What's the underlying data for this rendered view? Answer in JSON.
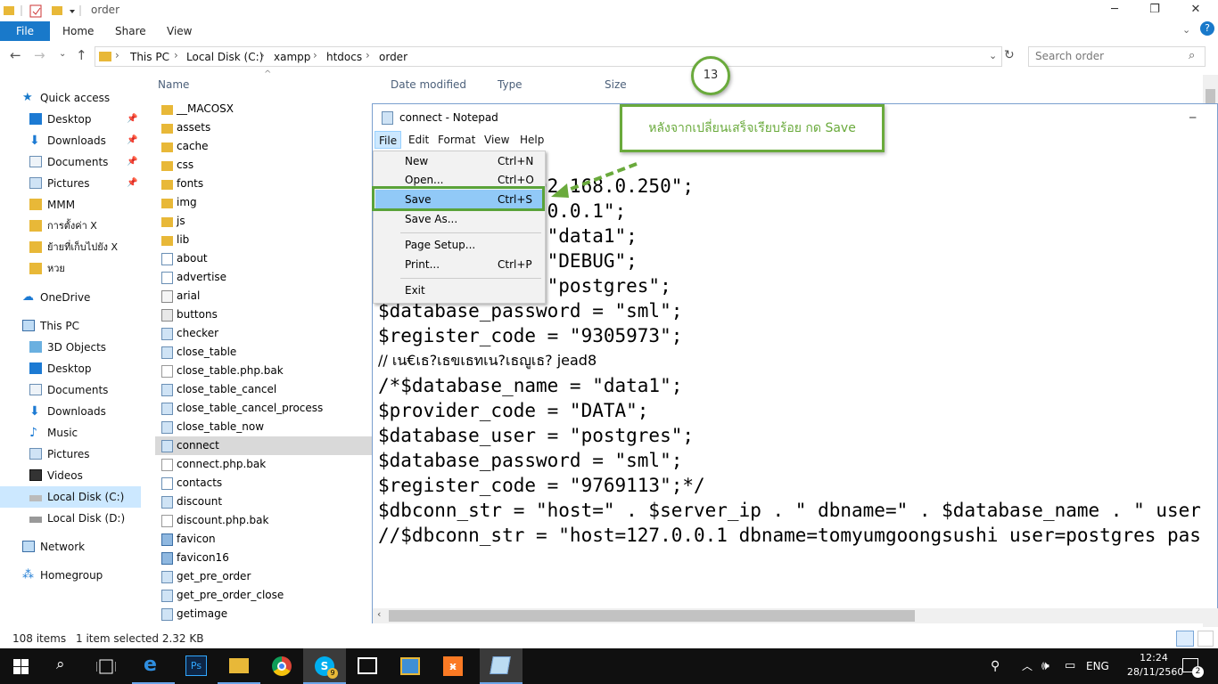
{
  "explorer": {
    "title": "order",
    "ribbon_tabs": {
      "file": "File",
      "home": "Home",
      "share": "Share",
      "view": "View"
    },
    "breadcrumb": [
      "This PC",
      "Local Disk (C:)",
      "xampp",
      "htdocs",
      "order"
    ],
    "search_placeholder": "Search order",
    "columns": {
      "name": "Name",
      "date": "Date modified",
      "type": "Type",
      "size": "Size"
    },
    "nav": {
      "quick_access": "Quick access",
      "desktop": "Desktop",
      "downloads": "Downloads",
      "documents": "Documents",
      "pictures": "Pictures",
      "mmm": "MMM",
      "settings_x": "การตั้งค่า X",
      "move_x": "ย้ายที่เก็บไปยัง X",
      "lost": "หวย",
      "onedrive": "OneDrive",
      "this_pc": "This PC",
      "objects_3d": "3D Objects",
      "desktop2": "Desktop",
      "documents2": "Documents",
      "downloads2": "Downloads",
      "music": "Music",
      "pictures2": "Pictures",
      "videos": "Videos",
      "local_c": "Local Disk (C:)",
      "local_d": "Local Disk (D:)",
      "network": "Network",
      "homegroup": "Homegroup"
    },
    "files": [
      {
        "name": "__MACOSX",
        "icon": "folder-icon"
      },
      {
        "name": "assets",
        "icon": "folder-icon"
      },
      {
        "name": "cache",
        "icon": "folder-icon"
      },
      {
        "name": "css",
        "icon": "folder-icon"
      },
      {
        "name": "fonts",
        "icon": "folder-icon"
      },
      {
        "name": "img",
        "icon": "folder-icon"
      },
      {
        "name": "js",
        "icon": "folder-icon"
      },
      {
        "name": "lib",
        "icon": "folder-icon"
      },
      {
        "name": "about",
        "icon": "html-file-icon"
      },
      {
        "name": "advertise",
        "icon": "html-file-icon"
      },
      {
        "name": "arial",
        "icon": "font-file-icon"
      },
      {
        "name": "buttons",
        "icon": "settings-file-icon"
      },
      {
        "name": "checker",
        "icon": "php-file-icon"
      },
      {
        "name": "close_table",
        "icon": "php-file-icon"
      },
      {
        "name": "close_table.php.bak",
        "icon": "blank-file-icon"
      },
      {
        "name": "close_table_cancel",
        "icon": "php-file-icon"
      },
      {
        "name": "close_table_cancel_process",
        "icon": "php-file-icon"
      },
      {
        "name": "close_table_now",
        "icon": "php-file-icon"
      },
      {
        "name": "connect",
        "icon": "php-file-icon",
        "selected": true
      },
      {
        "name": "connect.php.bak",
        "icon": "blank-file-icon"
      },
      {
        "name": "contacts",
        "icon": "html-file-icon"
      },
      {
        "name": "discount",
        "icon": "php-file-icon"
      },
      {
        "name": "discount.php.bak",
        "icon": "blank-file-icon"
      },
      {
        "name": "favicon",
        "icon": "image-file-icon"
      },
      {
        "name": "favicon16",
        "icon": "image-file-icon"
      },
      {
        "name": "get_pre_order",
        "icon": "php-file-icon"
      },
      {
        "name": "get_pre_order_close",
        "icon": "php-file-icon"
      },
      {
        "name": "getimage",
        "icon": "php-file-icon"
      }
    ],
    "status": {
      "count": "108 items",
      "selected": "1 item selected  2.32 KB"
    }
  },
  "notepad": {
    "title": "connect - Notepad",
    "menu": {
      "file": "File",
      "edit": "Edit",
      "format": "Format",
      "view": "View",
      "help": "Help"
    },
    "lines": [
      "             192.168.0.250\";",
      "             7.0.0.1\";",
      "             = \"data1\";",
      "             = \"DEBUG\";",
      "             = \"postgres\";",
      "$database_password = \"sml\";",
      "$register_code = \"9305973\";",
      "",
      "// เน€เธ?เธขเธทเน?เธญูเธ? jead8",
      "/*$database_name = \"data1\";",
      "$provider_code = \"DATA\";",
      "$database_user = \"postgres\";",
      "$database_password = \"sml\";",
      "$register_code = \"9769113\";*/",
      "",
      "$dbconn_str = \"host=\" . $server_ip . \" dbname=\" . $database_name . \" user",
      "//$dbconn_str = \"host=127.0.0.1 dbname=tomyumgoongsushi user=postgres pas"
    ]
  },
  "file_menu": {
    "new": "New",
    "new_sc": "Ctrl+N",
    "open": "Open...",
    "open_sc": "Ctrl+O",
    "save": "Save",
    "save_sc": "Ctrl+S",
    "save_as": "Save As...",
    "page_setup": "Page Setup...",
    "print": "Print...",
    "print_sc": "Ctrl+P",
    "exit": "Exit"
  },
  "annotation": {
    "step": "13",
    "callout": "หลังจากเปลี่ยนเสร็จเรียบร้อย กด Save"
  },
  "taskbar": {
    "lang": "ENG",
    "time": "12:24",
    "date": "28/11/2560",
    "notif_count": "2",
    "skype_badge": "9"
  },
  "colors": {
    "accent": "#1979ca",
    "annotation_green": "#6aaa3c",
    "selection": "#cce8ff"
  }
}
